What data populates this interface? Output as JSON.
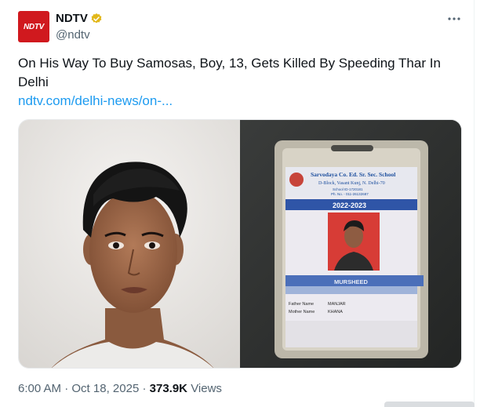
{
  "author": {
    "avatar_text": "NDTV",
    "name": "NDTV",
    "handle": "@ndtv",
    "verified": true,
    "brand_color": "#d0191e",
    "verified_color": "#e2b719"
  },
  "tweet": {
    "text": "On His Way To Buy Samosas, Boy, 13, Gets Killed By Speeding Thar In Delhi",
    "link": "ndtv.com/delhi-news/on-...",
    "link_color": "#1d9bf0"
  },
  "id_card": {
    "school_name": "Sarvodaya Co. Ed. Sr. Sec. School",
    "address": "D-Block, Vasant Kunj, N. Delhi-70",
    "school_id": "School ID-1720181",
    "phone": "Ph. No. - 011-26132687",
    "year": "2022-2023",
    "student_name": "MURSHEED",
    "father_label": "Father Name",
    "father_value": "MANJAR",
    "mother_label": "Mother Name",
    "mother_value": "KHANA"
  },
  "meta": {
    "time": "6:00 AM",
    "separator": "·",
    "date": "Oct 18, 2025",
    "views_count": "373.9K",
    "views_label": "Views"
  },
  "icons": {
    "more": "more-dots-icon",
    "verified": "verified-badge-icon"
  }
}
